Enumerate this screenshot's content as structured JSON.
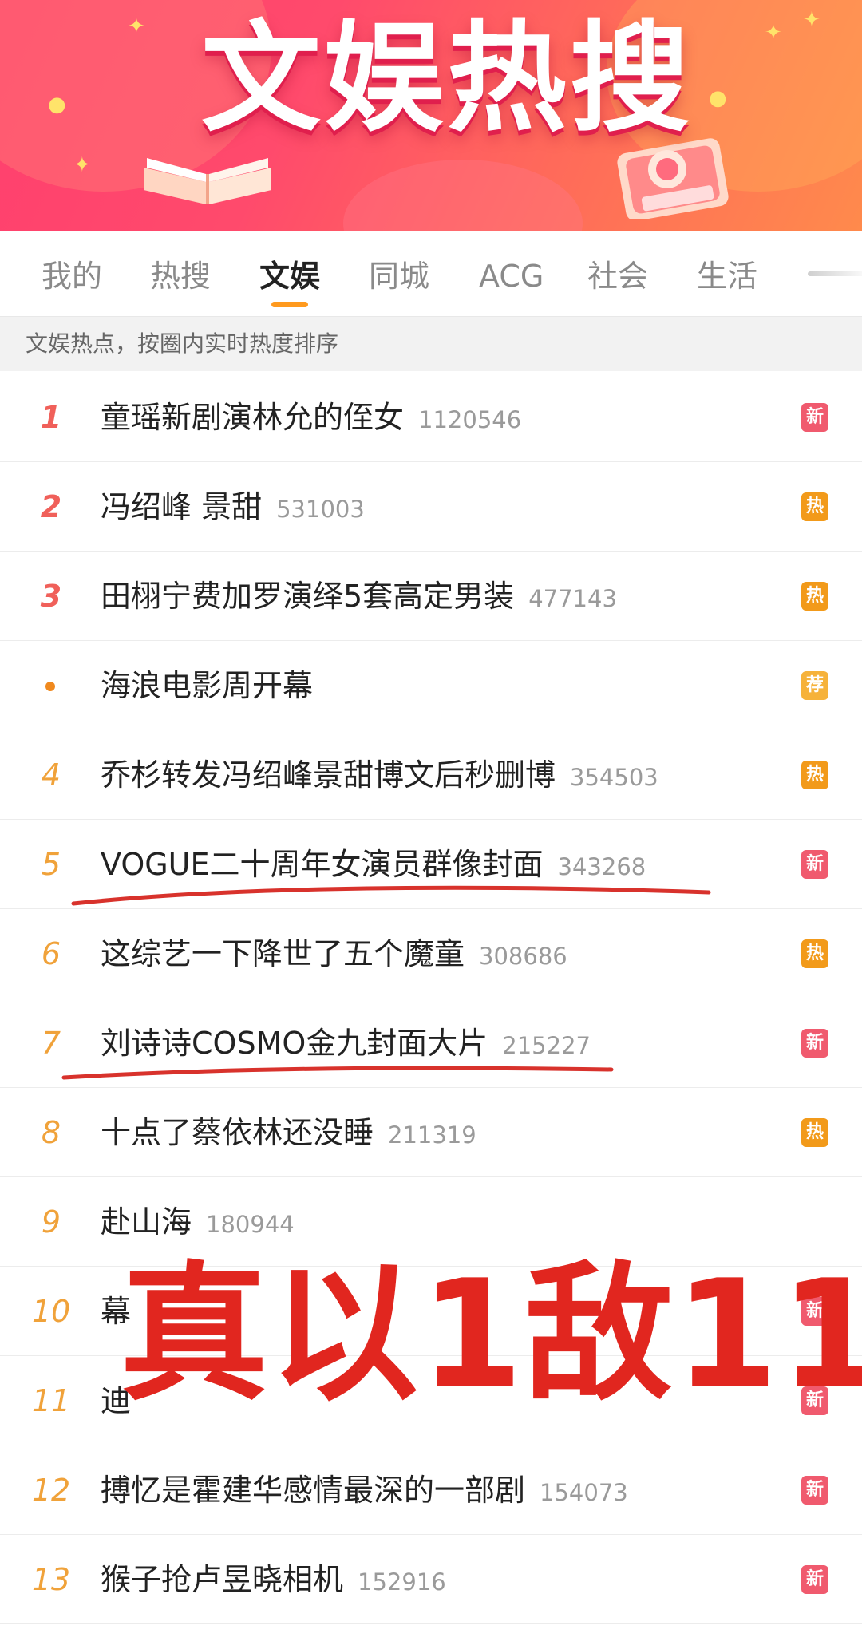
{
  "banner": {
    "title": "文娱热搜",
    "colors": {
      "start": "#ff3f6e",
      "end": "#ff8a4c",
      "title_shadow": "#e01f4d"
    }
  },
  "tabs": [
    {
      "label": "我的",
      "active": false
    },
    {
      "label": "热搜",
      "active": false
    },
    {
      "label": "文娱",
      "active": true
    },
    {
      "label": "同城",
      "active": false
    },
    {
      "label": "ACG",
      "active": false
    },
    {
      "label": "社会",
      "active": false
    },
    {
      "label": "生活",
      "active": false
    }
  ],
  "subtitle": "文娱热点，按圈内实时热度排序",
  "rows": [
    {
      "rank": "1",
      "title": "童瑶新剧演林允的侄女",
      "count": "1120546",
      "badge": "新",
      "badge_type": "new"
    },
    {
      "rank": "2",
      "title": "冯绍峰 景甜",
      "count": "531003",
      "badge": "热",
      "badge_type": "hot"
    },
    {
      "rank": "3",
      "title": "田栩宁费加罗演绎5套高定男装",
      "count": "477143",
      "badge": "热",
      "badge_type": "hot"
    },
    {
      "rank": "",
      "title": "海浪电影周开幕",
      "count": "",
      "badge": "荐",
      "badge_type": "rec"
    },
    {
      "rank": "4",
      "title": "乔杉转发冯绍峰景甜博文后秒删博",
      "count": "354503",
      "badge": "热",
      "badge_type": "hot"
    },
    {
      "rank": "5",
      "title": "VOGUE二十周年女演员群像封面",
      "count": "343268",
      "badge": "新",
      "badge_type": "new"
    },
    {
      "rank": "6",
      "title": "这综艺一下降世了五个魔童",
      "count": "308686",
      "badge": "热",
      "badge_type": "hot"
    },
    {
      "rank": "7",
      "title": "刘诗诗COSMO金九封面大片",
      "count": "215227",
      "badge": "新",
      "badge_type": "new"
    },
    {
      "rank": "8",
      "title": "十点了蔡依林还没睡",
      "count": "211319",
      "badge": "热",
      "badge_type": "hot"
    },
    {
      "rank": "9",
      "title": "赴山海",
      "count": "180944",
      "badge": "",
      "badge_type": ""
    },
    {
      "rank": "10",
      "title": "幕",
      "count": "",
      "badge": "新",
      "badge_type": "new"
    },
    {
      "rank": "11",
      "title": "迪",
      "count": "",
      "badge": "新",
      "badge_type": "new"
    },
    {
      "rank": "12",
      "title": "搏忆是霍建华感情最深的一部剧",
      "count": "154073",
      "badge": "新",
      "badge_type": "new"
    },
    {
      "rank": "13",
      "title": "猴子抢卢昱晓相机",
      "count": "152916",
      "badge": "新",
      "badge_type": "new"
    }
  ],
  "overlay": {
    "text": "真以1敌11",
    "color": "#e1261f"
  }
}
